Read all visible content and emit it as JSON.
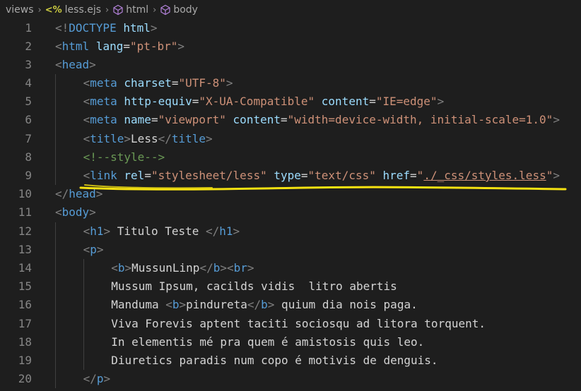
{
  "breadcrumb": {
    "items": [
      {
        "label": "views",
        "icon": ""
      },
      {
        "label": "less.ejs",
        "icon": "ejs-file-icon"
      },
      {
        "label": "html",
        "icon": "html-element-icon"
      },
      {
        "label": "body",
        "icon": "html-element-icon"
      }
    ]
  },
  "colors": {
    "background": "#1e1e1e",
    "tag": "#569cd6",
    "attribute": "#9cdcfe",
    "string": "#ce9178",
    "comment": "#6a9955",
    "text": "#d4d4d4",
    "line_number": "#858585",
    "highlight_ink": "#f5e211"
  },
  "lines": [
    {
      "n": "1",
      "indent": 0,
      "tokens": [
        [
          "br",
          "<!"
        ],
        [
          "tag",
          "DOCTYPE"
        ],
        [
          "txt",
          " "
        ],
        [
          "attr",
          "html"
        ],
        [
          "br",
          ">"
        ]
      ]
    },
    {
      "n": "2",
      "indent": 0,
      "tokens": [
        [
          "br",
          "<"
        ],
        [
          "tag",
          "html"
        ],
        [
          "txt",
          " "
        ],
        [
          "attr",
          "lang"
        ],
        [
          "txt",
          "="
        ],
        [
          "str",
          "\"pt-br\""
        ],
        [
          "br",
          ">"
        ]
      ]
    },
    {
      "n": "3",
      "indent": 0,
      "tokens": [
        [
          "br",
          "<"
        ],
        [
          "tag",
          "head"
        ],
        [
          "br",
          ">"
        ]
      ]
    },
    {
      "n": "4",
      "indent": 1,
      "tokens": [
        [
          "br",
          "<"
        ],
        [
          "tag",
          "meta"
        ],
        [
          "txt",
          " "
        ],
        [
          "attr",
          "charset"
        ],
        [
          "txt",
          "="
        ],
        [
          "str",
          "\"UTF-8\""
        ],
        [
          "br",
          ">"
        ]
      ]
    },
    {
      "n": "5",
      "indent": 1,
      "tokens": [
        [
          "br",
          "<"
        ],
        [
          "tag",
          "meta"
        ],
        [
          "txt",
          " "
        ],
        [
          "attr",
          "http-equiv"
        ],
        [
          "txt",
          "="
        ],
        [
          "str",
          "\"X-UA-Compatible\""
        ],
        [
          "txt",
          " "
        ],
        [
          "attr",
          "content"
        ],
        [
          "txt",
          "="
        ],
        [
          "str",
          "\"IE=edge\""
        ],
        [
          "br",
          ">"
        ]
      ]
    },
    {
      "n": "6",
      "indent": 1,
      "tokens": [
        [
          "br",
          "<"
        ],
        [
          "tag",
          "meta"
        ],
        [
          "txt",
          " "
        ],
        [
          "attr",
          "name"
        ],
        [
          "txt",
          "="
        ],
        [
          "str",
          "\"viewport\""
        ],
        [
          "txt",
          " "
        ],
        [
          "attr",
          "content"
        ],
        [
          "txt",
          "="
        ],
        [
          "str",
          "\"width=device-width, initial-scale=1.0\""
        ],
        [
          "br",
          ">"
        ]
      ]
    },
    {
      "n": "7",
      "indent": 1,
      "tokens": [
        [
          "br",
          "<"
        ],
        [
          "tag",
          "title"
        ],
        [
          "br",
          ">"
        ],
        [
          "txt",
          "Less"
        ],
        [
          "br",
          "</"
        ],
        [
          "tag",
          "title"
        ],
        [
          "br",
          ">"
        ]
      ]
    },
    {
      "n": "8",
      "indent": 1,
      "tokens": [
        [
          "cmt",
          "<!--style-->"
        ]
      ]
    },
    {
      "n": "9",
      "indent": 1,
      "tokens": [
        [
          "br",
          "<"
        ],
        [
          "tag",
          "link"
        ],
        [
          "txt",
          " "
        ],
        [
          "attr",
          "rel"
        ],
        [
          "txt",
          "="
        ],
        [
          "str",
          "\"stylesheet/less\""
        ],
        [
          "txt",
          " "
        ],
        [
          "attr",
          "type"
        ],
        [
          "txt",
          "="
        ],
        [
          "str",
          "\"text/css\""
        ],
        [
          "txt",
          " "
        ],
        [
          "attr",
          "href"
        ],
        [
          "txt",
          "="
        ],
        [
          "str",
          "\""
        ],
        [
          "strul",
          "./_css/styles.less"
        ],
        [
          "str",
          "\""
        ],
        [
          "br",
          ">"
        ]
      ]
    },
    {
      "n": "10",
      "indent": 0,
      "tokens": [
        [
          "br",
          "</"
        ],
        [
          "tag",
          "head"
        ],
        [
          "br",
          ">"
        ]
      ]
    },
    {
      "n": "11",
      "indent": 0,
      "tokens": [
        [
          "br",
          "<"
        ],
        [
          "tag",
          "body"
        ],
        [
          "br",
          ">"
        ]
      ]
    },
    {
      "n": "12",
      "indent": 1,
      "tokens": [
        [
          "br",
          "<"
        ],
        [
          "tag",
          "h1"
        ],
        [
          "br",
          ">"
        ],
        [
          "txt",
          " Titulo Teste "
        ],
        [
          "br",
          "</"
        ],
        [
          "tag",
          "h1"
        ],
        [
          "br",
          ">"
        ]
      ]
    },
    {
      "n": "13",
      "indent": 1,
      "tokens": [
        [
          "br",
          "<"
        ],
        [
          "tag",
          "p"
        ],
        [
          "br",
          ">"
        ]
      ]
    },
    {
      "n": "14",
      "indent": 2,
      "tokens": [
        [
          "br",
          "<"
        ],
        [
          "tag",
          "b"
        ],
        [
          "br",
          ">"
        ],
        [
          "txt",
          "MussunLinp"
        ],
        [
          "br",
          "</"
        ],
        [
          "tag",
          "b"
        ],
        [
          "br",
          ">"
        ],
        [
          "br",
          "<"
        ],
        [
          "tag",
          "br"
        ],
        [
          "br",
          ">"
        ]
      ]
    },
    {
      "n": "15",
      "indent": 2,
      "tokens": [
        [
          "txt",
          "Mussum Ipsum, cacilds vidis  litro abertis"
        ]
      ]
    },
    {
      "n": "16",
      "indent": 2,
      "tokens": [
        [
          "txt",
          "Manduma "
        ],
        [
          "br",
          "<"
        ],
        [
          "tag",
          "b"
        ],
        [
          "br",
          ">"
        ],
        [
          "txt",
          "pindureta"
        ],
        [
          "br",
          "</"
        ],
        [
          "tag",
          "b"
        ],
        [
          "br",
          ">"
        ],
        [
          "txt",
          " quium dia nois paga."
        ]
      ]
    },
    {
      "n": "17",
      "indent": 2,
      "tokens": [
        [
          "txt",
          "Viva Forevis aptent taciti sociosqu ad litora torquent."
        ]
      ]
    },
    {
      "n": "18",
      "indent": 2,
      "tokens": [
        [
          "txt",
          "In elementis mé pra quem é amistosis quis leo."
        ]
      ]
    },
    {
      "n": "19",
      "indent": 2,
      "tokens": [
        [
          "txt",
          "Diuretics paradis num copo é motivis de denguis."
        ]
      ]
    },
    {
      "n": "20",
      "indent": 1,
      "tokens": [
        [
          "br",
          "</"
        ],
        [
          "tag",
          "p"
        ],
        [
          "br",
          ">"
        ]
      ]
    }
  ]
}
